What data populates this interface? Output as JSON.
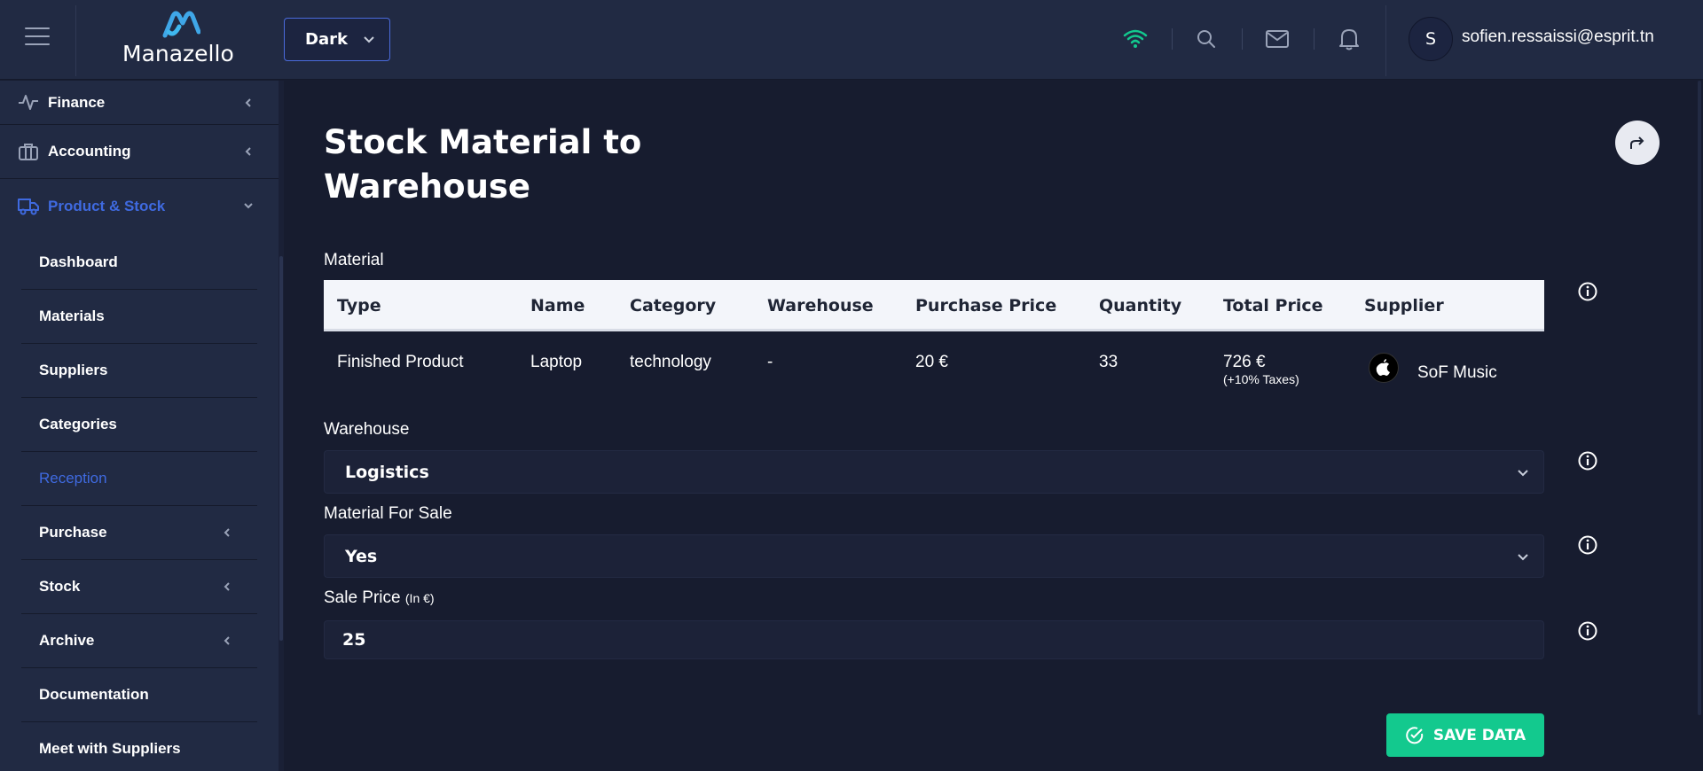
{
  "app": {
    "logo_text": "Manazello"
  },
  "header": {
    "theme_select": {
      "value": "Dark"
    },
    "user": {
      "avatar_initial": "S",
      "email": "sofien.ressaissi@esprit.tn"
    }
  },
  "sidebar": {
    "items": [
      {
        "label": "Finance",
        "icon": "pulse-icon"
      },
      {
        "label": "Accounting",
        "icon": "briefcase-icon"
      },
      {
        "label": "Product & Stock",
        "icon": "truck-icon"
      }
    ],
    "subitems": [
      {
        "label": "Dashboard"
      },
      {
        "label": "Materials"
      },
      {
        "label": "Suppliers"
      },
      {
        "label": "Categories"
      },
      {
        "label": "Reception"
      },
      {
        "label": "Purchase"
      },
      {
        "label": "Stock"
      },
      {
        "label": "Archive"
      },
      {
        "label": "Documentation"
      },
      {
        "label": "Meet with Suppliers"
      }
    ]
  },
  "page": {
    "title": "Stock Material to Warehouse",
    "material_label": "Material",
    "table": {
      "headers": [
        "Type",
        "Name",
        "Category",
        "Warehouse",
        "Purchase Price",
        "Quantity",
        "Total Price",
        "Supplier"
      ],
      "row": {
        "type": "Finished Product",
        "name": "Laptop",
        "category": "technology",
        "warehouse": "-",
        "purchase_price": "20 €",
        "quantity": "33",
        "total_price": "726 €",
        "taxes_note": "(+10% Taxes)",
        "supplier": "SoF Music"
      }
    },
    "warehouse_label": "Warehouse",
    "warehouse_value": "Logistics",
    "for_sale_label": "Material For Sale",
    "for_sale_value": "Yes",
    "sale_price_label": "Sale Price",
    "sale_price_unit": "(In €)",
    "sale_price_value": "25",
    "save_label": "SAVE DATA"
  },
  "colors": {
    "accent": "#3f6ae0",
    "success": "#13c98e",
    "wifi": "#13c98e",
    "topbar_bg": "#212a43",
    "page_bg": "#171c2f"
  }
}
